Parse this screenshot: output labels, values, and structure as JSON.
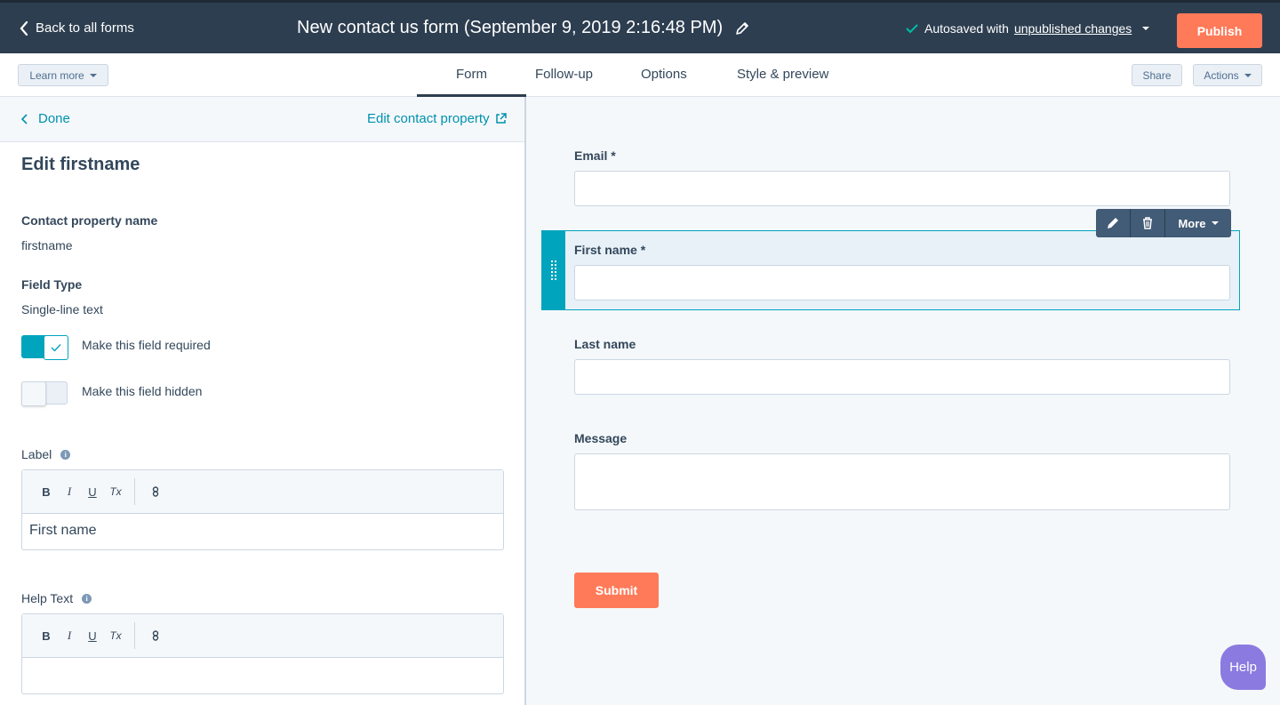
{
  "header": {
    "back_label": "Back to all forms",
    "form_title": "New contact us form (September 9, 2019 2:16:48 PM)",
    "autosave_prefix": "Autosaved with",
    "autosave_link": "unpublished changes",
    "publish_label": "Publish"
  },
  "tabbar": {
    "learn_more": "Learn more",
    "tabs": [
      {
        "label": "Form",
        "active": true
      },
      {
        "label": "Follow-up"
      },
      {
        "label": "Options"
      },
      {
        "label": "Style & preview"
      }
    ],
    "share": "Share",
    "actions": "Actions"
  },
  "left_panel": {
    "done": "Done",
    "edit_property": "Edit contact property",
    "heading": "Edit firstname",
    "prop_name_label": "Contact property name",
    "prop_name_value": "firstname",
    "field_type_label": "Field Type",
    "field_type_value": "Single-line text",
    "required_label": "Make this field required",
    "required_on": true,
    "hidden_label": "Make this field hidden",
    "hidden_on": false,
    "label_label": "Label",
    "label_value": "First name",
    "help_text_label": "Help Text",
    "help_text_value": "",
    "rte_buttons": [
      "B",
      "I",
      "U",
      "Tx"
    ]
  },
  "preview": {
    "fields": [
      {
        "label": "Email *"
      },
      {
        "label": "First name *",
        "selected": true
      },
      {
        "label": "Last name"
      },
      {
        "label": "Message"
      }
    ],
    "toolbar_more": "More",
    "submit": "Submit"
  },
  "help_button": "Help",
  "colors": {
    "header_bg": "#2d3e50",
    "accent_orange": "#ff7a59",
    "accent_teal": "#00a4bd",
    "link": "#0091ae"
  }
}
